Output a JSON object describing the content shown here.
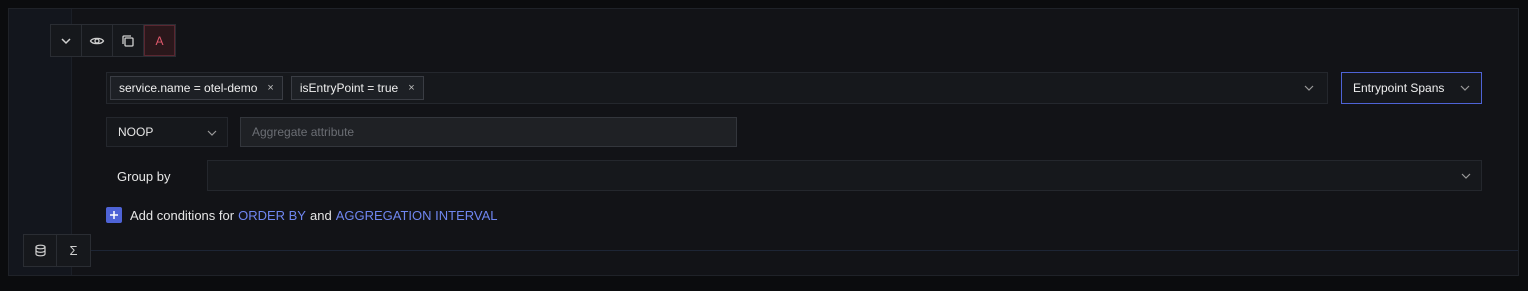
{
  "toolbar": {
    "buttons": [
      {
        "icon": "chevron-down-icon"
      },
      {
        "icon": "eye-icon"
      },
      {
        "icon": "copy-icon"
      },
      {
        "label": "A"
      }
    ]
  },
  "filter": {
    "tags": [
      {
        "text": "service.name = otel-demo",
        "remove": "×"
      },
      {
        "text": "isEntryPoint = true",
        "remove": "×"
      }
    ]
  },
  "span_select": {
    "value": "Entrypoint Spans"
  },
  "aggregate": {
    "operator": "NOOP",
    "attribute_placeholder": "Aggregate attribute"
  },
  "group_by": {
    "label": "Group by",
    "value": ""
  },
  "add_conditions": {
    "prefix": "Add conditions for",
    "order_by": "ORDER BY",
    "and": "and",
    "aggregation_interval": "AGGREGATION INTERVAL"
  },
  "bottom_toolbar": {
    "buttons": [
      {
        "icon": "database-icon"
      },
      {
        "label": "Σ",
        "icon": "sigma-icon"
      }
    ]
  },
  "colors": {
    "accent": "#4e63d6",
    "link": "#6f86f0",
    "query_label": "#e2596d",
    "background": "#121317"
  }
}
